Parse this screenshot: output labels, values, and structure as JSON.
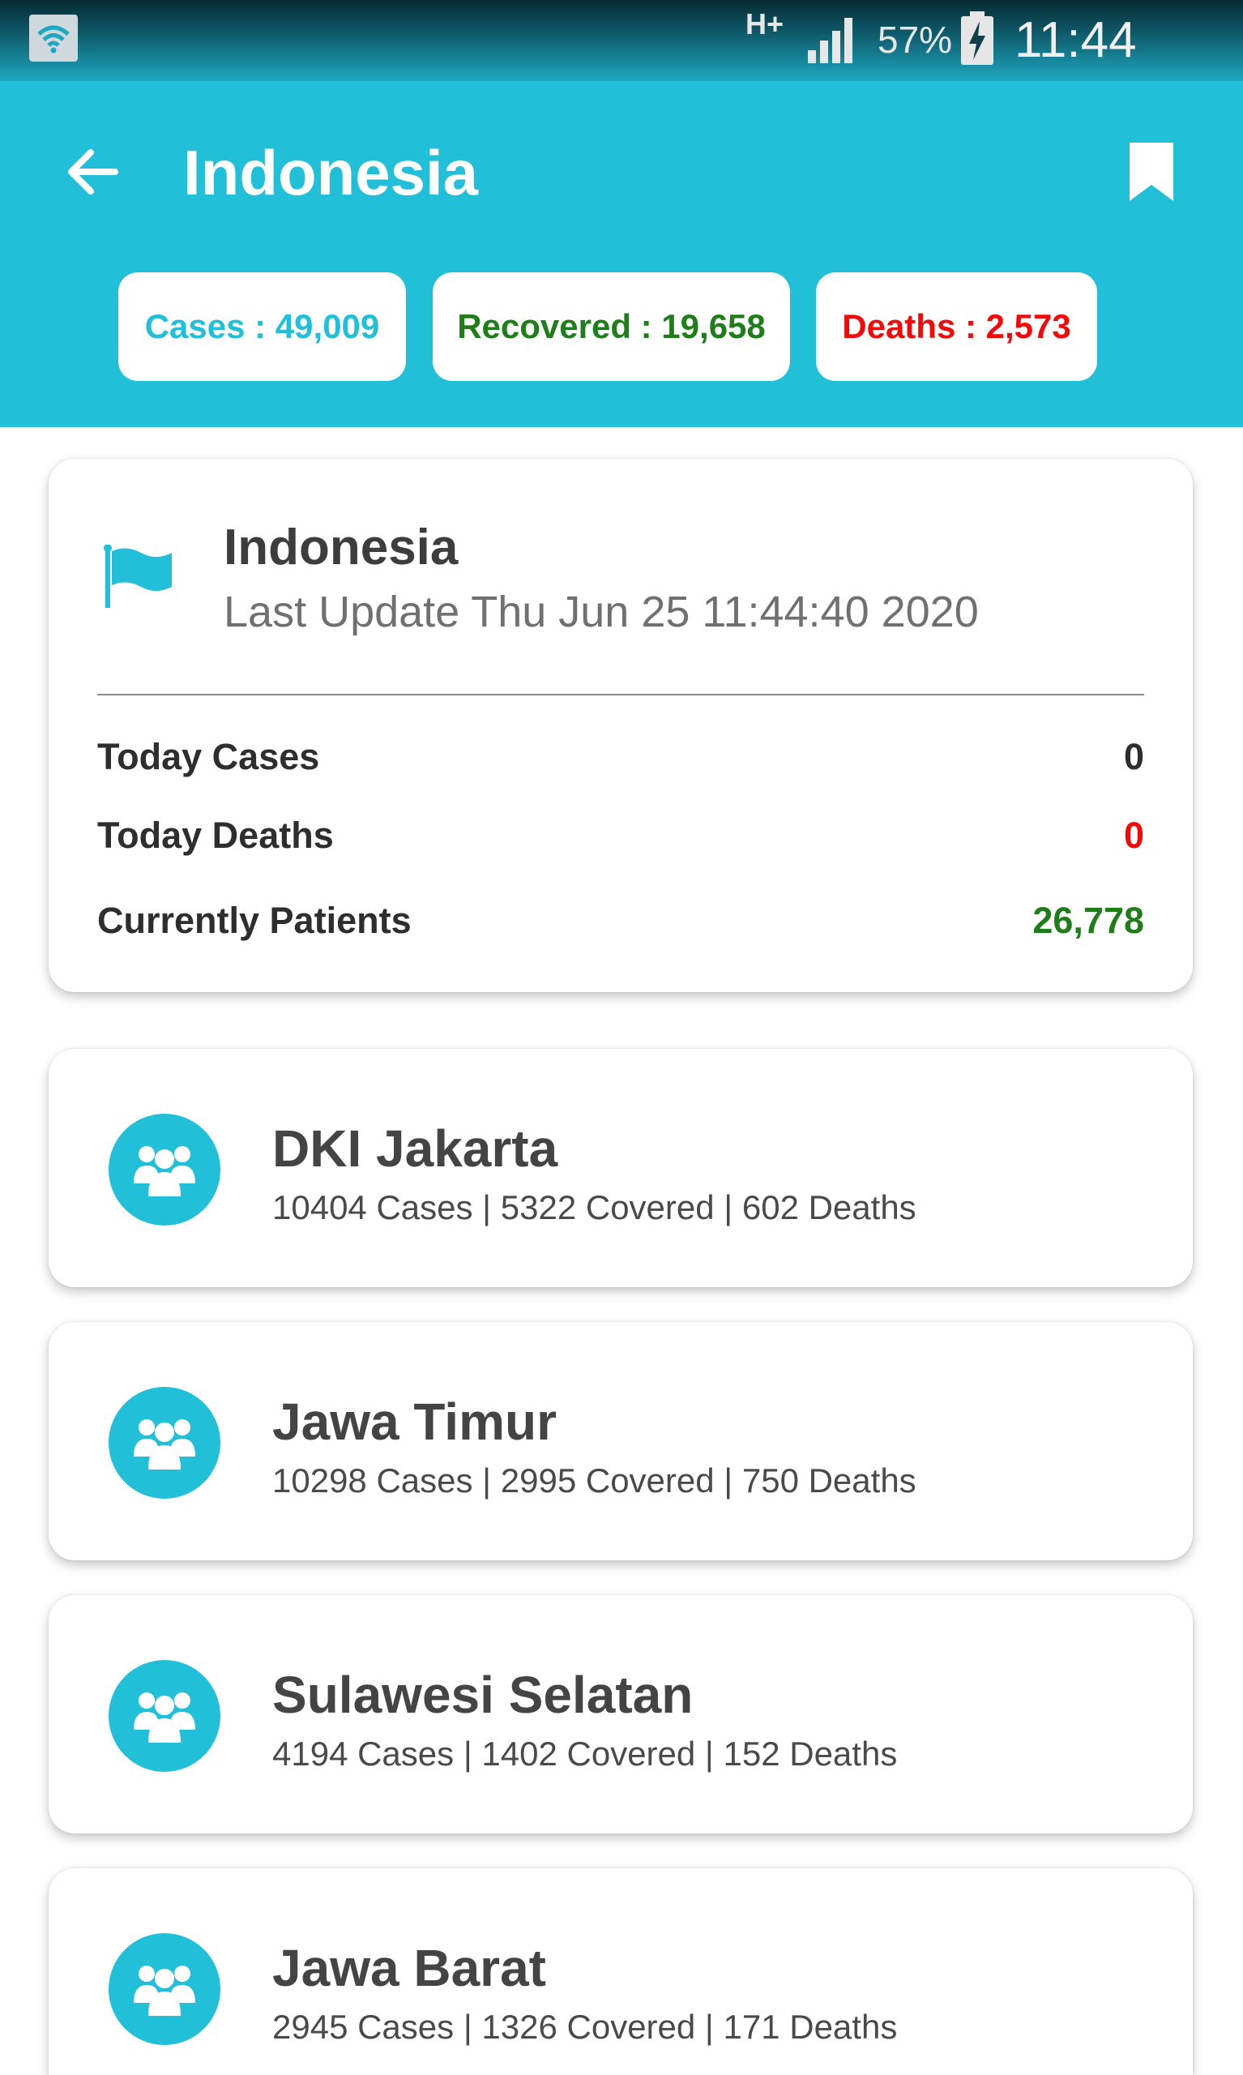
{
  "status_bar": {
    "network_type": "H+",
    "battery_percent": "57%",
    "time": "11:44",
    "icons": [
      "wifi-icon",
      "signal-icon",
      "battery-charging-icon"
    ]
  },
  "app_bar": {
    "title": "Indonesia",
    "back_icon": "arrow-left-icon",
    "bookmark_icon": "bookmark-icon"
  },
  "summary_chips": {
    "cases": "Cases : 49,009",
    "recovered": "Recovered : 19,658",
    "deaths": "Deaths : 2,573"
  },
  "summary_card": {
    "icon": "flag-icon",
    "country": "Indonesia",
    "last_update": "Last Update Thu Jun 25 11:44:40 2020",
    "rows": [
      {
        "label": "Today Cases",
        "value": "0"
      },
      {
        "label": "Today Deaths",
        "value": "0"
      },
      {
        "label": "Currently Patients",
        "value": "26,778"
      }
    ]
  },
  "provinces": [
    {
      "name": "DKI Jakarta",
      "stats": "10404 Cases | 5322 Covered | 602 Deaths"
    },
    {
      "name": "Jawa Timur",
      "stats": "10298 Cases | 2995 Covered | 750 Deaths"
    },
    {
      "name": "Sulawesi Selatan",
      "stats": "4194 Cases | 1402 Covered | 152 Deaths"
    },
    {
      "name": "Jawa Barat",
      "stats": "2945 Cases | 1326 Covered | 171 Deaths"
    }
  ],
  "colors": {
    "primary": "#22bfd9",
    "recovered": "#1f7d1a",
    "deaths": "#f00a0a"
  }
}
